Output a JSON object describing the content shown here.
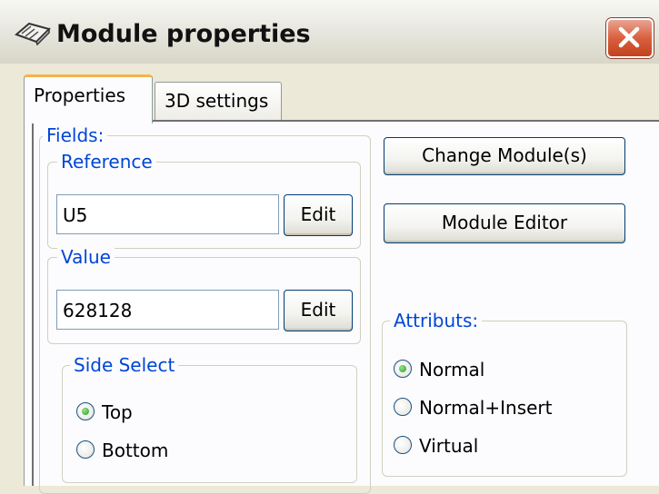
{
  "window": {
    "title": "Module properties",
    "icon": "module-icon",
    "close_icon": "close-icon"
  },
  "tabs": [
    {
      "label": "Properties",
      "selected": true
    },
    {
      "label": "3D settings",
      "selected": false
    }
  ],
  "fields": {
    "legend": "Fields:",
    "reference": {
      "legend": "Reference",
      "value": "U5",
      "edit_label": "Edit"
    },
    "value": {
      "legend": "Value",
      "value": "628128",
      "edit_label": "Edit"
    }
  },
  "side_select": {
    "legend": "Side Select",
    "options": [
      {
        "label": "Top",
        "checked": true
      },
      {
        "label": "Bottom",
        "checked": false
      }
    ]
  },
  "actions": {
    "change_module_label": "Change Module(s)",
    "module_editor_label": "Module Editor"
  },
  "attributs": {
    "legend": "Attributs:",
    "options": [
      {
        "label": "Normal",
        "checked": true
      },
      {
        "label": "Normal+Insert",
        "checked": false
      },
      {
        "label": "Virtual",
        "checked": false
      }
    ]
  },
  "colors": {
    "legend_text": "#0046d5",
    "tab_highlight": "#f5b34a",
    "close_button": "#d9603f"
  }
}
